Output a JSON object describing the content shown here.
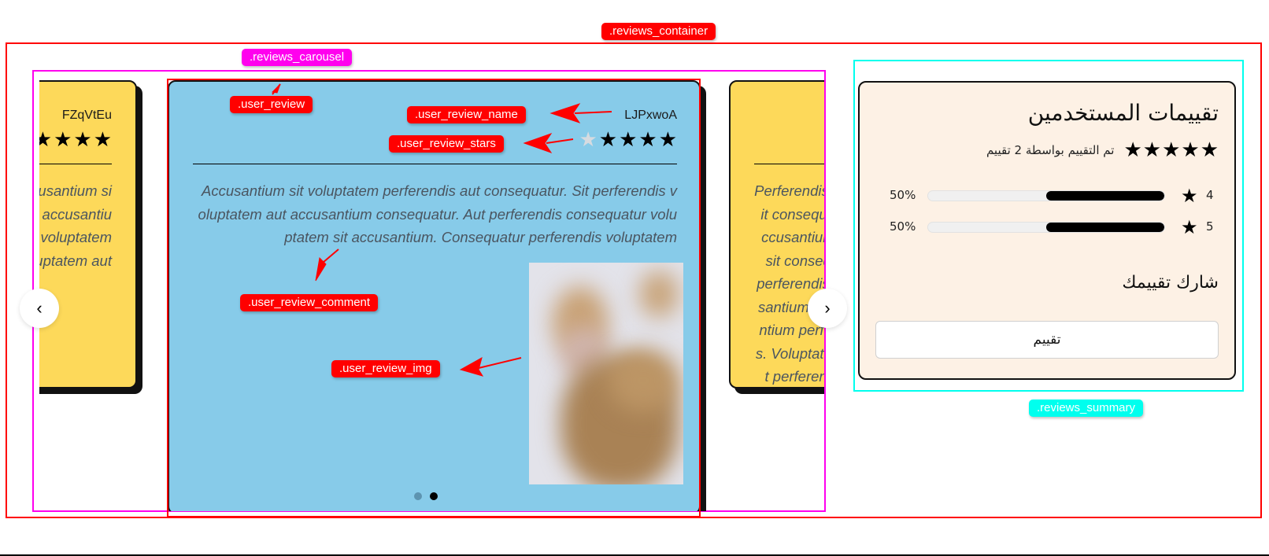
{
  "annotations": {
    "reviews_container": ".reviews_container",
    "reviews_carousel": ".reviews_carousel",
    "user_review": ".user_review",
    "user_review_name": ".user_review_name",
    "user_review_stars": ".user_review_stars",
    "user_review_comment": ".user_review_comment",
    "user_review_img": ".user_review_img",
    "reviews_summary": ".reviews_summary"
  },
  "carousel": {
    "prev_icon": "‹",
    "next_icon": "›",
    "active_dot_index": 1,
    "dot_count": 2,
    "reviews": [
      {
        "name": "FZqVtEu",
        "rating": 4,
        "comment": "Accusantium sit voluptatem perferendis aut consequatur. Accusantium sit voluptatem aut accusantium consequatur. Accusantium au r accusantium voluptatem. Consequatur voluptatem aut. Perferendis aut voluptatem sit accusantium voluptat s consequatur. Voluptatem aut"
      },
      {
        "name": "LJPxwoA",
        "rating": 4,
        "max_rating": 5,
        "comment": "Accusantium sit voluptatem perferendis aut consequatur. Sit perferendis voluptatem aut accusantium consequatur. Aut perferendis consequatur voluptatem sit accusantium. Consequatur perferendis voluptatem",
        "has_image": true
      },
      {
        "name": "",
        "rating": 0,
        "comment": "Perferendis aut sit consequatur accusantium. Aut sit consequatur perferendis accusantium. Accusantium perferendis. Voluptatem aut perferendis sit accusantium. Voluptatem aut perferendis"
      }
    ]
  },
  "summary": {
    "title": "تقييمات المستخدمين",
    "average_stars": 5,
    "rated_by_text": "تم التقييم بواسطة 2 تقييم",
    "breakdown": [
      {
        "star": "4",
        "percent_label": "50%",
        "percent": 50
      },
      {
        "star": "5",
        "percent_label": "50%",
        "percent": 50
      }
    ],
    "share_label": "شارك تقييمك",
    "rate_button": "تقييم"
  }
}
